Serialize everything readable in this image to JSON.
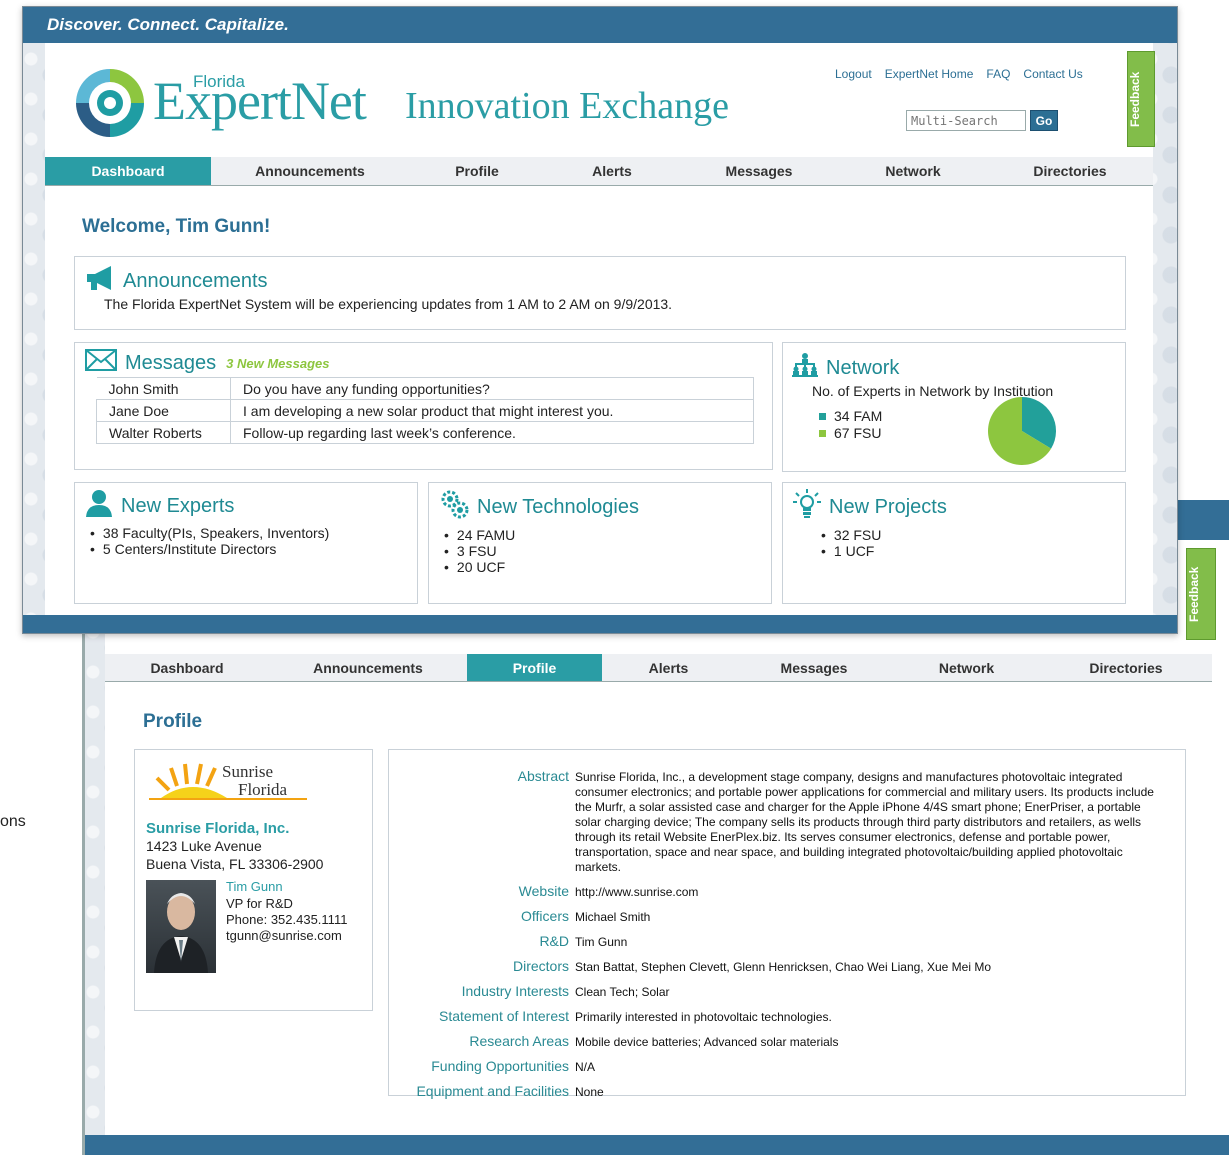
{
  "header": {
    "tagline": "Discover. Connect. Capitalize.",
    "logo_florida": "Florida",
    "logo_main": "ExpertNet",
    "logo_sub": "Innovation Exchange",
    "links": [
      "Logout",
      "ExpertNet Home",
      "FAQ",
      "Contact Us"
    ],
    "search_placeholder": "Multi-Search",
    "go_label": "Go",
    "feedback_label": "Feedback"
  },
  "nav": [
    "Dashboard",
    "Announcements",
    "Profile",
    "Alerts",
    "Messages",
    "Network",
    "Directories"
  ],
  "dashboard": {
    "welcome": "Welcome, Tim Gunn!",
    "announcements": {
      "title": "Announcements",
      "text": "The Florida ExpertNet System will be experiencing updates from 1 AM to 2 AM on 9/9/2013."
    },
    "messages": {
      "title": "Messages",
      "new_count": "3 New Messages",
      "rows": [
        {
          "from": "John Smith",
          "subject": "Do you have any funding opportunities?"
        },
        {
          "from": "Jane Doe",
          "subject": "I am developing a new solar product that might interest you."
        },
        {
          "from": "Walter Roberts",
          "subject": "Follow-up regarding last week’s conference."
        }
      ]
    },
    "network": {
      "title": "Network",
      "subtitle": "No. of Experts in Network by Institution",
      "legend": [
        "34 FAM",
        "67 FSU"
      ]
    },
    "new_experts": {
      "title": "New Experts",
      "items": [
        "38 Faculty(PIs, Speakers, Inventors)",
        "5 Centers/Institute Directors"
      ]
    },
    "new_technologies": {
      "title": "New Technologies",
      "items": [
        "24 FAMU",
        "3 FSU",
        "20 UCF"
      ]
    },
    "new_projects": {
      "title": "New Projects",
      "items": [
        "32 FSU",
        "1 UCF"
      ]
    }
  },
  "chart_data": {
    "type": "pie",
    "categories": [
      "FAM",
      "FSU"
    ],
    "values": [
      34,
      67
    ],
    "colors": [
      "#22a09a",
      "#8dc63f"
    ]
  },
  "profile": {
    "title": "Profile",
    "logo_line1": "Sunrise",
    "logo_line2": "Florida",
    "company": "Sunrise Florida, Inc.",
    "address1": "1423 Luke Avenue",
    "address2": "Buena Vista, FL  33306-2900",
    "contact_name": "Tim Gunn",
    "contact_title": "VP for R&D",
    "contact_phone": "Phone: 352.435.1111",
    "contact_email": "tgunn@sunrise.com",
    "fields": [
      {
        "label": "Abstract",
        "value": "Sunrise Florida, Inc., a development stage company, designs and manufactures photovoltaic integrated consumer electronics; and portable power applications for commercial and military users. Its products include the Murfr, a solar assisted case and charger for the Apple iPhone 4/4S smart phone; EnerPriser, a portable solar charging device; The company sells its products through third party distributors and retailers, as wells through its retail Website EnerPlex.biz. Its serves consumer electronics, defense and portable power, transportation, space and near space, and building integrated photovoltaic/building applied photovoltaic markets."
      },
      {
        "label": "Website",
        "value": "http://www.sunrise.com"
      },
      {
        "label": "Officers",
        "value": "Michael Smith"
      },
      {
        "label": "R&D",
        "value": "Tim Gunn"
      },
      {
        "label": "Directors",
        "value": "Stan Battat, Stephen Clevett, Glenn Henricksen, Chao Wei Liang, Xue Mei Mo"
      },
      {
        "label": "Industry Interests",
        "value": "Clean Tech; Solar"
      },
      {
        "label": "Statement of Interest",
        "value": "Primarily interested in photovoltaic technologies."
      },
      {
        "label": "Research Areas",
        "value": "Mobile device batteries; Advanced solar materials"
      },
      {
        "label": "Funding Opportunities",
        "value": "N/A"
      },
      {
        "label": "Equipment and Facilities",
        "value": "None"
      }
    ]
  },
  "partial_text": "ons"
}
